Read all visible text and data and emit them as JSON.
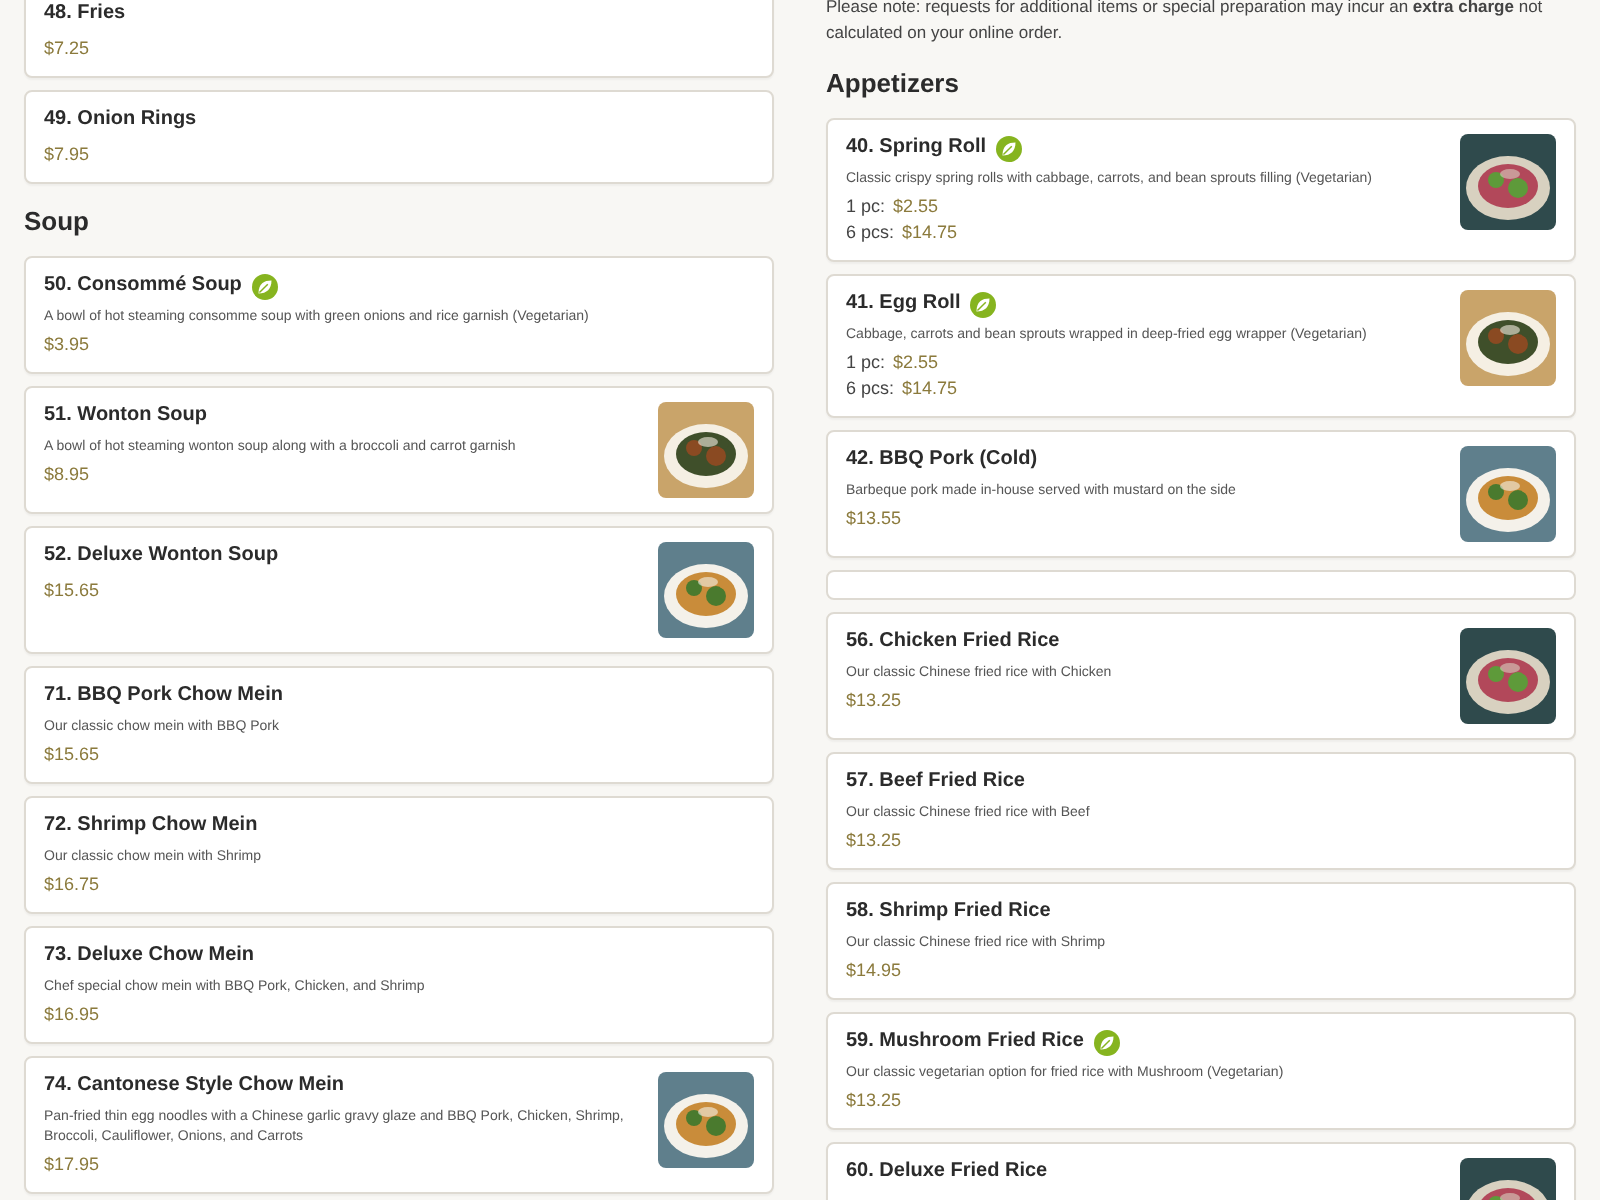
{
  "left_column": [
    {
      "kind": "item",
      "title": "48. Fries",
      "vegetarian": false,
      "photo": false,
      "prices": [
        {
          "price": "$7.25"
        }
      ]
    },
    {
      "kind": "item",
      "title": "49. Onion Rings",
      "vegetarian": false,
      "photo": false,
      "prices": [
        {
          "price": "$7.95"
        }
      ]
    },
    {
      "kind": "heading",
      "text": "Soup"
    },
    {
      "kind": "item",
      "title": "50. Consommé Soup",
      "vegetarian": true,
      "photo": false,
      "description": "A bowl of hot steaming consomme soup with green onions and rice garnish (Vegetarian)",
      "prices": [
        {
          "price": "$3.95"
        }
      ]
    },
    {
      "kind": "item",
      "title": "51. Wonton Soup",
      "vegetarian": false,
      "photo": true,
      "description": "A bowl of hot steaming wonton soup along with a broccoli and carrot garnish",
      "prices": [
        {
          "price": "$8.95"
        }
      ]
    },
    {
      "kind": "item",
      "title": "52. Deluxe Wonton Soup",
      "vegetarian": false,
      "photo": true,
      "prices": [
        {
          "price": "$15.65"
        }
      ]
    },
    {
      "kind": "item",
      "title": "71. BBQ Pork Chow Mein",
      "vegetarian": false,
      "photo": false,
      "description": "Our classic chow mein with BBQ Pork",
      "prices": [
        {
          "price": "$15.65"
        }
      ]
    },
    {
      "kind": "item",
      "title": "72. Shrimp Chow Mein",
      "vegetarian": false,
      "photo": false,
      "description": "Our classic chow mein with Shrimp",
      "prices": [
        {
          "price": "$16.75"
        }
      ]
    },
    {
      "kind": "item",
      "title": "73. Deluxe Chow Mein",
      "vegetarian": false,
      "photo": false,
      "description": "Chef special chow mein with BBQ Pork, Chicken, and Shrimp",
      "prices": [
        {
          "price": "$16.95"
        }
      ]
    },
    {
      "kind": "item",
      "title": "74. Cantonese Style Chow Mein",
      "vegetarian": false,
      "photo": true,
      "description": "Pan-fried thin egg noodles with a Chinese garlic gravy glaze and BBQ Pork, Chicken, Shrimp, Broccoli, Cauliflower, Onions, and Carrots",
      "prices": [
        {
          "price": "$17.95"
        }
      ]
    }
  ],
  "right_column": [
    {
      "kind": "note",
      "text": "Please note: requests for additional items or special preparation may incur an **extra charge** not calculated on your online order."
    },
    {
      "kind": "heading",
      "text": "Appetizers"
    },
    {
      "kind": "item",
      "title": "40. Spring Roll",
      "vegetarian": true,
      "photo": true,
      "description": "Classic crispy spring rolls with cabbage, carrots, and bean sprouts filling (Vegetarian)",
      "prices": [
        {
          "label": "1 pc:",
          "price": "$2.55"
        },
        {
          "label": "6 pcs:",
          "price": "$14.75"
        }
      ]
    },
    {
      "kind": "item",
      "title": "41. Egg Roll",
      "vegetarian": true,
      "photo": true,
      "description": "Cabbage, carrots and bean sprouts wrapped in deep-fried egg wrapper (Vegetarian)",
      "prices": [
        {
          "label": "1 pc:",
          "price": "$2.55"
        },
        {
          "label": "6 pcs:",
          "price": "$14.75"
        }
      ]
    },
    {
      "kind": "item",
      "title": "42. BBQ Pork (Cold)",
      "vegetarian": false,
      "photo": true,
      "description": "Barbeque pork made in-house served with mustard on the side",
      "prices": [
        {
          "price": "$13.55"
        }
      ]
    },
    {
      "kind": "blank"
    },
    {
      "kind": "item",
      "title": "56. Chicken Fried Rice",
      "vegetarian": false,
      "photo": true,
      "description": "Our classic Chinese fried rice with Chicken",
      "prices": [
        {
          "price": "$13.25"
        }
      ]
    },
    {
      "kind": "item",
      "title": "57. Beef Fried Rice",
      "vegetarian": false,
      "photo": false,
      "description": "Our classic Chinese fried rice with Beef",
      "prices": [
        {
          "price": "$13.25"
        }
      ]
    },
    {
      "kind": "item",
      "title": "58. Shrimp Fried Rice",
      "vegetarian": false,
      "photo": false,
      "description": "Our classic Chinese fried rice with Shrimp",
      "prices": [
        {
          "price": "$14.95"
        }
      ]
    },
    {
      "kind": "item",
      "title": "59. Mushroom Fried Rice",
      "vegetarian": true,
      "photo": false,
      "description": "Our classic vegetarian option for fried rice with Mushroom (Vegetarian)",
      "prices": [
        {
          "price": "$13.25"
        }
      ]
    },
    {
      "kind": "item",
      "title": "60. Deluxe Fried Rice",
      "vegetarian": false,
      "photo": true
    }
  ]
}
